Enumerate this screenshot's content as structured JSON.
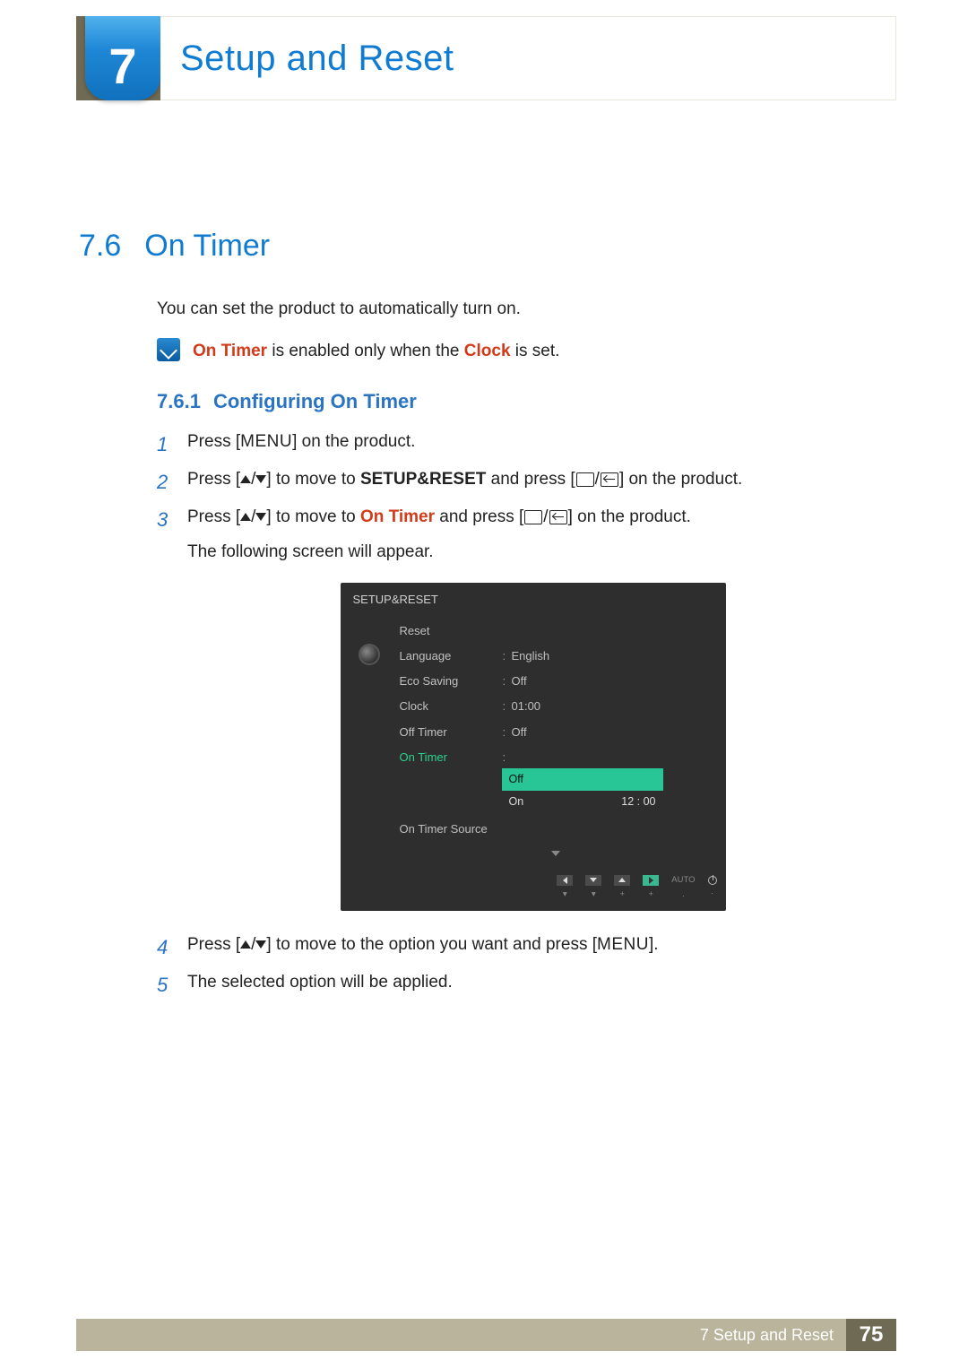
{
  "chapter": {
    "number": "7",
    "title": "Setup and Reset"
  },
  "section": {
    "number": "7.6",
    "title": "On Timer"
  },
  "intro": "You can set the product to automatically turn on.",
  "note": {
    "pre": "On Timer",
    "mid": " is enabled only when the ",
    "key": "Clock",
    "post": " is set."
  },
  "subsection": {
    "number": "7.6.1",
    "title": "Configuring On Timer"
  },
  "steps": {
    "s1": {
      "a": "Press [",
      "menu": "MENU",
      "b": "] on the product."
    },
    "s2": {
      "a": "Press [",
      "b": "] to move to ",
      "target": "SETUP&RESET",
      "c": " and press [",
      "d": "] on the product."
    },
    "s3": {
      "a": "Press [",
      "b": "] to move to ",
      "target": "On Timer",
      "c": " and press [",
      "d": "] on the product.",
      "tail": "The following screen will appear."
    },
    "s4": {
      "a": "Press [",
      "b": "] to move to the option you want and press [",
      "menu": "MENU",
      "c": "]."
    },
    "s5": "The selected option will be applied."
  },
  "osd": {
    "title": "SETUP&RESET",
    "rows": {
      "reset": {
        "label": "Reset",
        "value": ""
      },
      "language": {
        "label": "Language",
        "value": "English"
      },
      "eco": {
        "label": "Eco Saving",
        "value": "Off"
      },
      "clock": {
        "label": "Clock",
        "value": "01:00"
      },
      "offtimer": {
        "label": "Off Timer",
        "value": "Off"
      },
      "ontimer": {
        "label": "On Timer"
      },
      "source": {
        "label": "On Timer Source",
        "value": ""
      }
    },
    "popup": {
      "off": "Off",
      "on": "On",
      "time": "12 : 00"
    },
    "footer": {
      "auto": "AUTO"
    }
  },
  "footer": {
    "label": "7 Setup and Reset",
    "page": "75"
  }
}
